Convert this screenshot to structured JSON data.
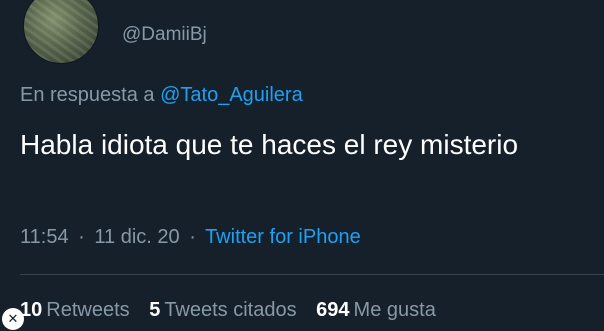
{
  "tweet": {
    "display_name": "□□ ▲ □□□□□□□□",
    "handle": "@DamiiBj",
    "reply_prefix": "En respuesta a",
    "reply_to": "@Tato_Aguilera",
    "text": "Habla idiota que te haces el rey misterio",
    "time": "11:54",
    "date": "11 dic. 20",
    "separator": "·",
    "source": "Twitter for iPhone"
  },
  "stats": {
    "retweets_count": "10",
    "retweets_label": "Retweets",
    "quotes_count": "5",
    "quotes_label": "Tweets citados",
    "likes_count": "694",
    "likes_label": "Me gusta"
  },
  "overlay": {
    "badge_icon": "x-icon",
    "badge_glyph": "✕"
  },
  "colors": {
    "background": "#15202b",
    "text": "#ffffff",
    "muted": "#8899a6",
    "accent": "#1da1f2",
    "divider": "#38444d"
  }
}
